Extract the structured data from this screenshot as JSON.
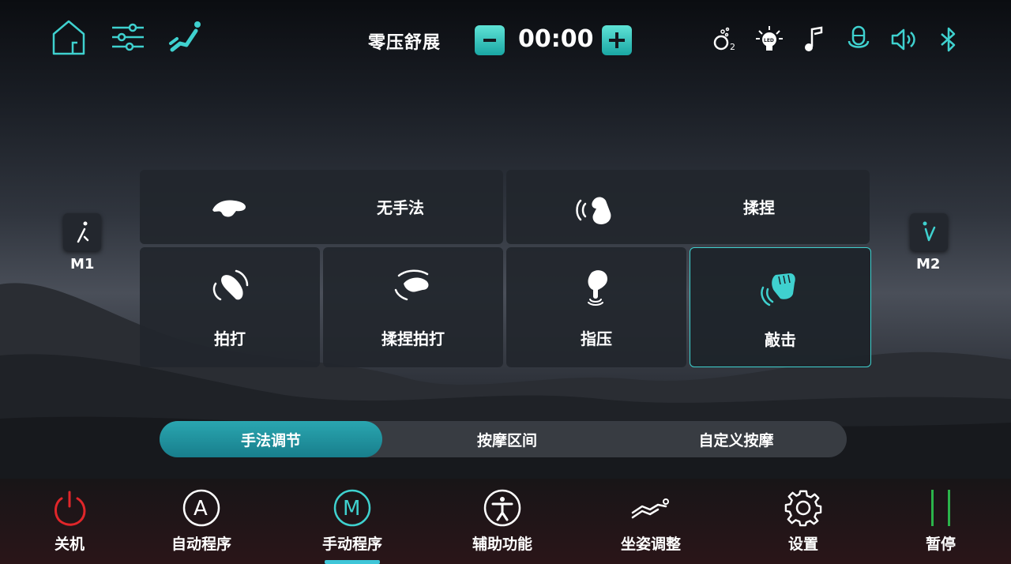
{
  "header": {
    "mode_title": "零压舒展",
    "timer": "00:00",
    "left_icons": [
      "home-icon",
      "sliders-icon",
      "recline-seat-icon"
    ],
    "status_icons": [
      "oxygen-icon",
      "led-icon",
      "music-icon",
      "voice-icon",
      "volume-icon",
      "bluetooth-icon"
    ]
  },
  "side": {
    "m1_label": "M1",
    "m2_label": "M2"
  },
  "techniques": {
    "none": "无手法",
    "knead": "揉捏",
    "tap": "拍打",
    "knead_tap": "揉捏拍打",
    "shiatsu": "指压",
    "knock": "敲击",
    "selected": "敲击"
  },
  "tabs": {
    "technique": "手法调节",
    "zone": "按摩区间",
    "custom": "自定义按摩",
    "active": "手法调节"
  },
  "bottom_nav": {
    "power": "关机",
    "auto": "自动程序",
    "manual": "手动程序",
    "assist": "辅助功能",
    "posture": "坐姿调整",
    "settings": "设置",
    "pause": "暂停",
    "active": "手动程序"
  },
  "colors": {
    "accent": "#3fd1cf",
    "power_red": "#e0262a",
    "pause_green": "#2bb34a"
  }
}
